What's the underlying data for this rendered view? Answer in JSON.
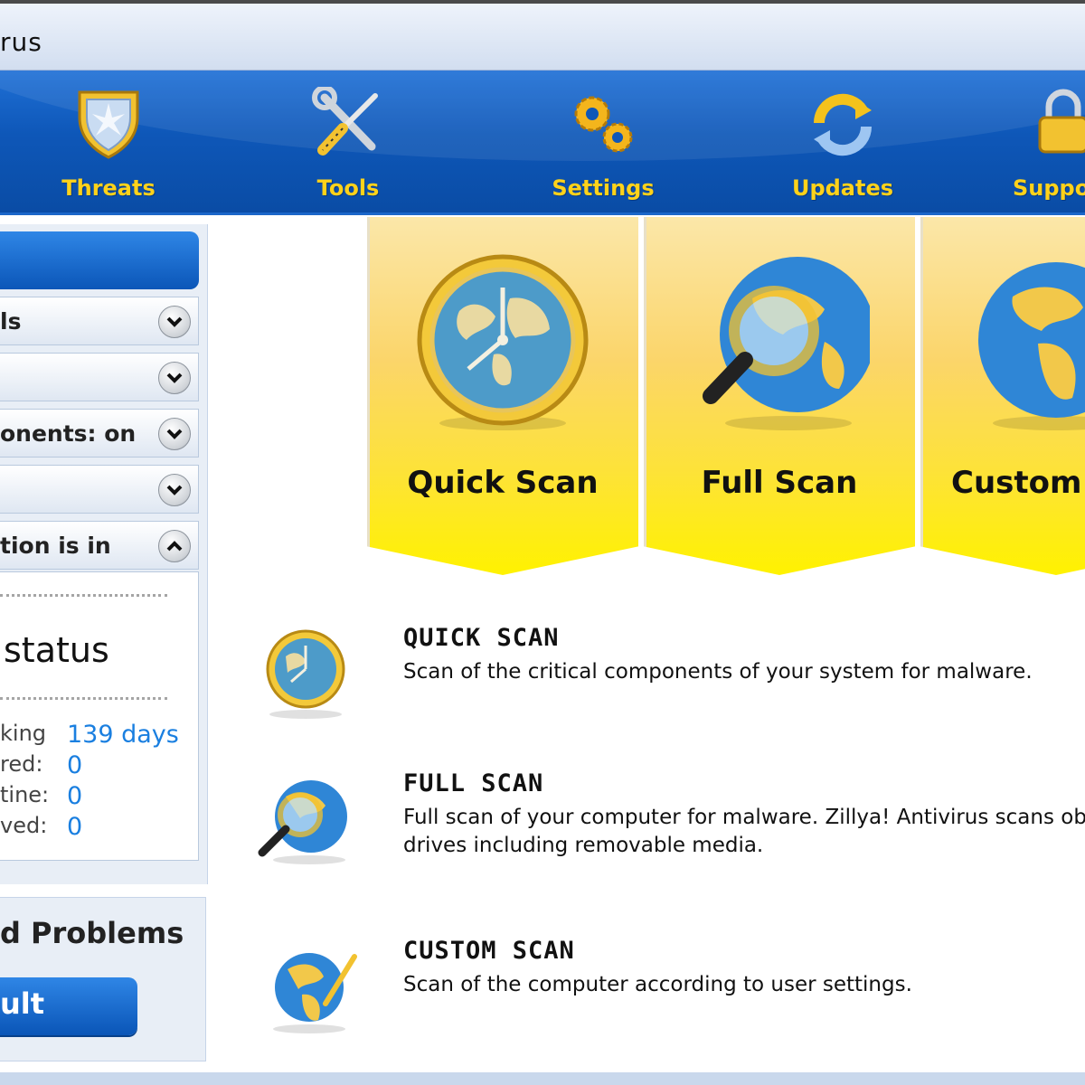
{
  "window": {
    "title": "rus"
  },
  "toolbar": {
    "items": [
      {
        "label": "Threats",
        "icon": "shield-icon"
      },
      {
        "label": "Tools",
        "icon": "wrench-screwdriver-icon"
      },
      {
        "label": "Settings",
        "icon": "gears-icon"
      },
      {
        "label": "Updates",
        "icon": "refresh-icon"
      },
      {
        "label": "Suppo",
        "icon": "lock-icon"
      }
    ]
  },
  "sidebar": {
    "rows": [
      {
        "label": "ls",
        "state": "collapsed"
      },
      {
        "label": "",
        "state": "collapsed"
      },
      {
        "label": "onents: on",
        "state": "collapsed"
      },
      {
        "label": "",
        "state": "collapsed"
      },
      {
        "label": "tion is in",
        "state": "expanded"
      }
    ],
    "status": {
      "title": "status",
      "stats": [
        {
          "label": "king",
          "value": "139 days"
        },
        {
          "label": "red:",
          "value": "0"
        },
        {
          "label": "tine:",
          "value": "0"
        },
        {
          "label": "ved:",
          "value": "0"
        }
      ]
    },
    "problems": {
      "title": "d Problems",
      "button_label": "ult"
    }
  },
  "scan_cards": [
    {
      "label": "Quick Scan",
      "icon": "clock-globe-icon"
    },
    {
      "label": "Full Scan",
      "icon": "magnifier-globe-icon"
    },
    {
      "label": "Custom",
      "icon": "pen-globe-icon"
    }
  ],
  "descriptions": [
    {
      "title": "QUICK SCAN",
      "lines": [
        "Scan of the critical components of your system for malware."
      ]
    },
    {
      "title": "FULL SCAN",
      "lines": [
        "Full scan of your computer for malware. Zillya! Antivirus scans objects",
        "drives including removable media."
      ]
    },
    {
      "title": "CUSTOM SCAN",
      "lines": [
        "Scan of the computer according to user settings."
      ]
    }
  ],
  "colors": {
    "toolbar_blue": "#0e57b8",
    "toolbar_label": "#ffd21a",
    "stat_value": "#1a7fe0",
    "card_yellow": "#fde23a"
  }
}
